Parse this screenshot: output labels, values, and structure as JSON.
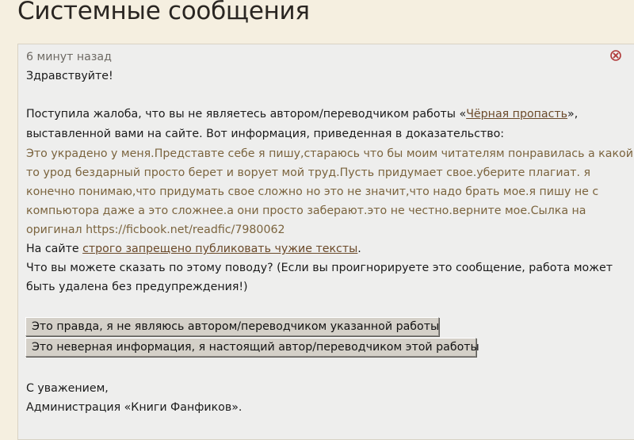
{
  "page": {
    "title": "Системные сообщения"
  },
  "message": {
    "timestamp": "6 минут назад",
    "close_icon": "close-circle-icon",
    "greeting": "Здравствуйте!",
    "complaint_prefix": "Поступила жалоба, что вы не являетесь автором/переводчиком работы «",
    "work_title": "Чёрная пропасть",
    "complaint_suffix": "»,",
    "complaint_line2": "выставленной вами на сайте. Вот информация, приведенная в доказательство:",
    "evidence_lines": [
      "Это украдено у меня.Представте себе я пишу,стараюсь что бы моим читателям понравилась а какой",
      "то урод бездарный просто берет и ворует мой труд.Пусть придумает свое.уберите плагиат. я",
      "конечно понимаю,что придумать свое сложно но это не значит,что надо брать мое.я пишу не с",
      "компьютора даже а это сложнее.а они просто заберают.это не честно.верните мое.Сылка на",
      "оригинал https://ficbook.net/readfic/7980062"
    ],
    "rule_prefix": "На сайте ",
    "rule_link": "строго запрещено публиковать чужие тексты",
    "rule_suffix": ".",
    "question_line1": "Что вы можете сказать по этому поводу? (Если вы проигнорируете это сообщение, работа может",
    "question_line2": "быть удалена без предупреждения!)",
    "buttons": {
      "admit": "Это правда, я не являюсь автором/переводчиком указанной работы",
      "dispute": "Это неверная информация, я настоящий автор/переводчиком этой работы"
    },
    "sign_off": "С уважением,",
    "signature": "Администрация «Книги Фанфиков»."
  },
  "colors": {
    "background": "#f5efe0",
    "panel": "#eeeeed",
    "evidence_text": "#7b643e",
    "link": "#6b4a2a",
    "close_icon": "#b03a3a"
  }
}
